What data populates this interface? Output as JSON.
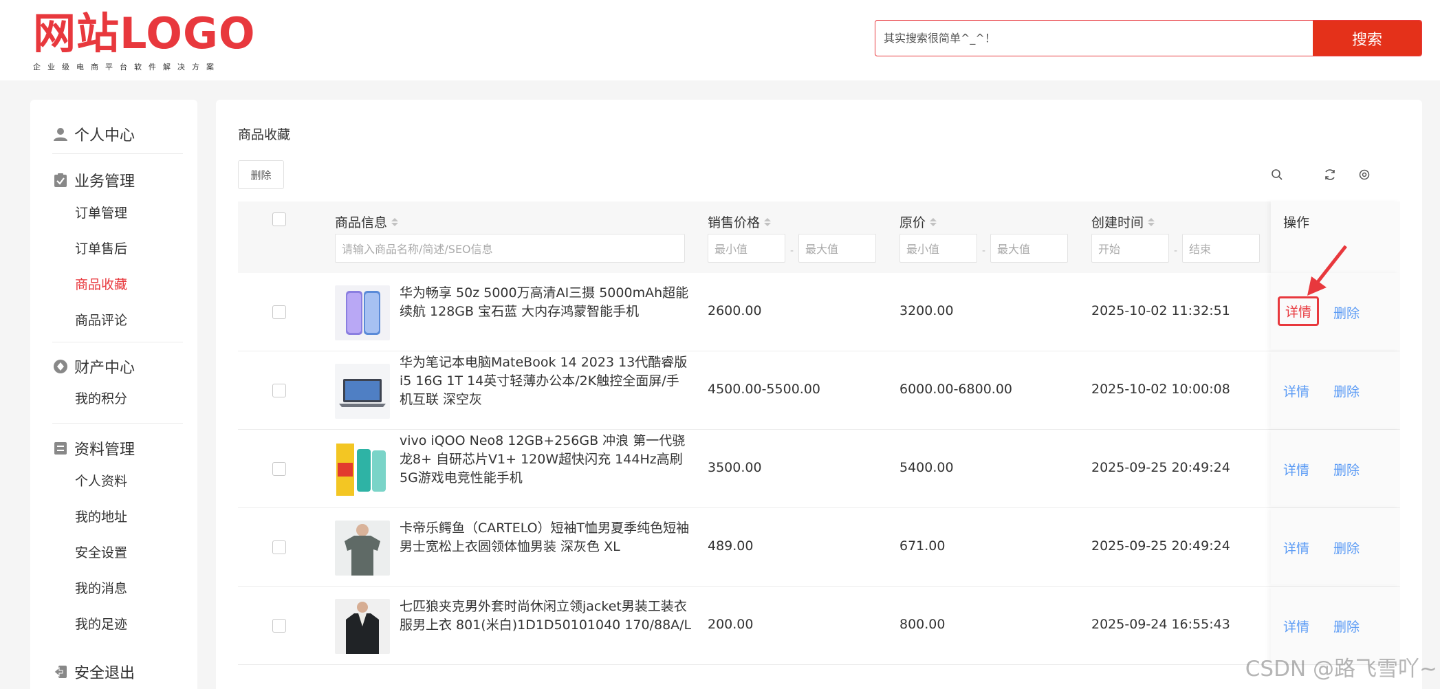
{
  "header": {
    "logo_text": "网站LOGO",
    "logo_slogan": "企业级电商平台软件解决方案",
    "search_placeholder": "其实搜索很简单^_^！",
    "search_button": "搜索"
  },
  "sidebar": {
    "groups": [
      {
        "label": "个人中心",
        "icon": "user-icon",
        "items": []
      },
      {
        "label": "业务管理",
        "icon": "clipboard-icon",
        "items": [
          "订单管理",
          "订单售后",
          "商品收藏",
          "商品评论"
        ]
      },
      {
        "label": "财产中心",
        "icon": "coin-icon",
        "items": [
          "我的积分"
        ]
      },
      {
        "label": "资料管理",
        "icon": "document-icon",
        "items": [
          "个人资料",
          "我的地址",
          "安全设置",
          "我的消息",
          "我的足迹"
        ]
      },
      {
        "label": "安全退出",
        "icon": "logout-icon",
        "items": []
      }
    ],
    "active_item": "商品收藏"
  },
  "main": {
    "title": "商品收藏",
    "delete_button": "删除",
    "toolbar_icons": [
      "search-icon",
      "refresh-icon",
      "settings-icon"
    ],
    "columns": {
      "product": "商品信息",
      "sale_price": "销售价格",
      "original_price": "原价",
      "created_at": "创建时间",
      "actions": "操作"
    },
    "filters": {
      "product_placeholder": "请输入商品名称/简述/SEO信息",
      "min": "最小值",
      "max": "最大值",
      "start": "开始",
      "end": "结束"
    },
    "rows": [
      {
        "name": "华为畅享 50z 5000万高清AI三摄 5000mAh超能续航 128GB 宝石蓝 大内存鸿蒙智能手机",
        "sale_price": "2600.00",
        "original_price": "3200.00",
        "created_at": "2025-10-02 11:32:51",
        "detail": "详情",
        "delete": "删除"
      },
      {
        "name": "华为笔记本电脑MateBook 14 2023 13代酷睿版 i5 16G 1T 14英寸轻薄办公本/2K触控全面屏/手机互联 深空灰",
        "sale_price": "4500.00-5500.00",
        "original_price": "6000.00-6800.00",
        "created_at": "2025-10-02 10:00:08",
        "detail": "详情",
        "delete": "删除"
      },
      {
        "name": "vivo iQOO Neo8 12GB+256GB 冲浪 第一代骁龙8+ 自研芯片V1+ 120W超快闪充 144Hz高刷 5G游戏电竞性能手机",
        "sale_price": "3500.00",
        "original_price": "5400.00",
        "created_at": "2025-09-25 20:49:24",
        "detail": "详情",
        "delete": "删除"
      },
      {
        "name": "卡帝乐鳄鱼（CARTELO）短袖T恤男夏季纯色短袖男士宽松上衣圆领体恤男装 深灰色 XL",
        "sale_price": "489.00",
        "original_price": "671.00",
        "created_at": "2025-09-25 20:49:24",
        "detail": "详情",
        "delete": "删除"
      },
      {
        "name": "七匹狼夹克男外套时尚休闲立领jacket男装工装衣服男上衣 801(米白)1D1D50101040 170/88A/L",
        "sale_price": "200.00",
        "original_price": "800.00",
        "created_at": "2025-09-24 16:55:43",
        "detail": "详情",
        "delete": "删除"
      }
    ]
  },
  "watermark": "CSDN @路飞雪吖~",
  "colors": {
    "brand": "#e8383d",
    "search_button": "#e4311a",
    "link": "#5b9bf5"
  }
}
